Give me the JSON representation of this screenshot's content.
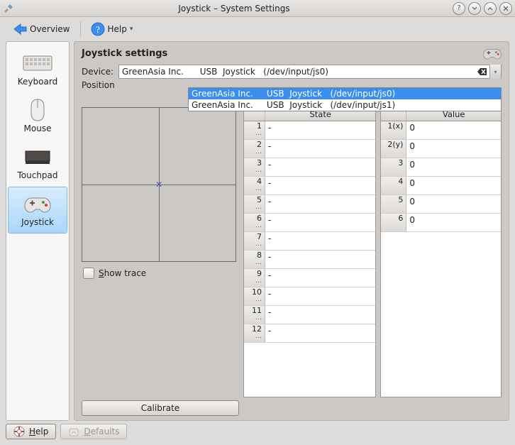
{
  "window": {
    "title": "Joystick – System Settings"
  },
  "toolbar": {
    "overview": "Overview",
    "help": "Help"
  },
  "sidebar": {
    "items": [
      {
        "label": "Keyboard"
      },
      {
        "label": "Mouse"
      },
      {
        "label": "Touchpad"
      },
      {
        "label": "Joystick"
      }
    ]
  },
  "page": {
    "title": "Joystick settings",
    "device_label": "Device:",
    "position_label": "Position",
    "show_trace_label": "Show trace",
    "calibrate_label": "Calibrate"
  },
  "device_combo": {
    "value": "GreenAsia Inc.      USB  Joystick   (/dev/input/js0)",
    "options": [
      "GreenAsia Inc.     USB  Joystick   (/dev/input/js0)",
      "GreenAsia Inc.     USB  Joystick   (/dev/input/js1)"
    ]
  },
  "state_table": {
    "header": "State",
    "rows": [
      {
        "n": "1",
        "v": "-"
      },
      {
        "n": "2",
        "v": "-"
      },
      {
        "n": "3",
        "v": "-"
      },
      {
        "n": "4",
        "v": "-"
      },
      {
        "n": "5",
        "v": "-"
      },
      {
        "n": "6",
        "v": "-"
      },
      {
        "n": "7",
        "v": "-"
      },
      {
        "n": "8",
        "v": "-"
      },
      {
        "n": "9",
        "v": "-"
      },
      {
        "n": "10",
        "v": "-"
      },
      {
        "n": "11",
        "v": "-"
      },
      {
        "n": "12",
        "v": "-"
      }
    ]
  },
  "value_table": {
    "header": "Value",
    "rows": [
      {
        "n": "1(x)",
        "v": "0"
      },
      {
        "n": "2(y)",
        "v": "0"
      },
      {
        "n": "3",
        "v": "0"
      },
      {
        "n": "4",
        "v": "0"
      },
      {
        "n": "5",
        "v": "0"
      },
      {
        "n": "6",
        "v": "0"
      }
    ]
  },
  "bottom": {
    "help": "Help",
    "defaults": "Defaults"
  }
}
